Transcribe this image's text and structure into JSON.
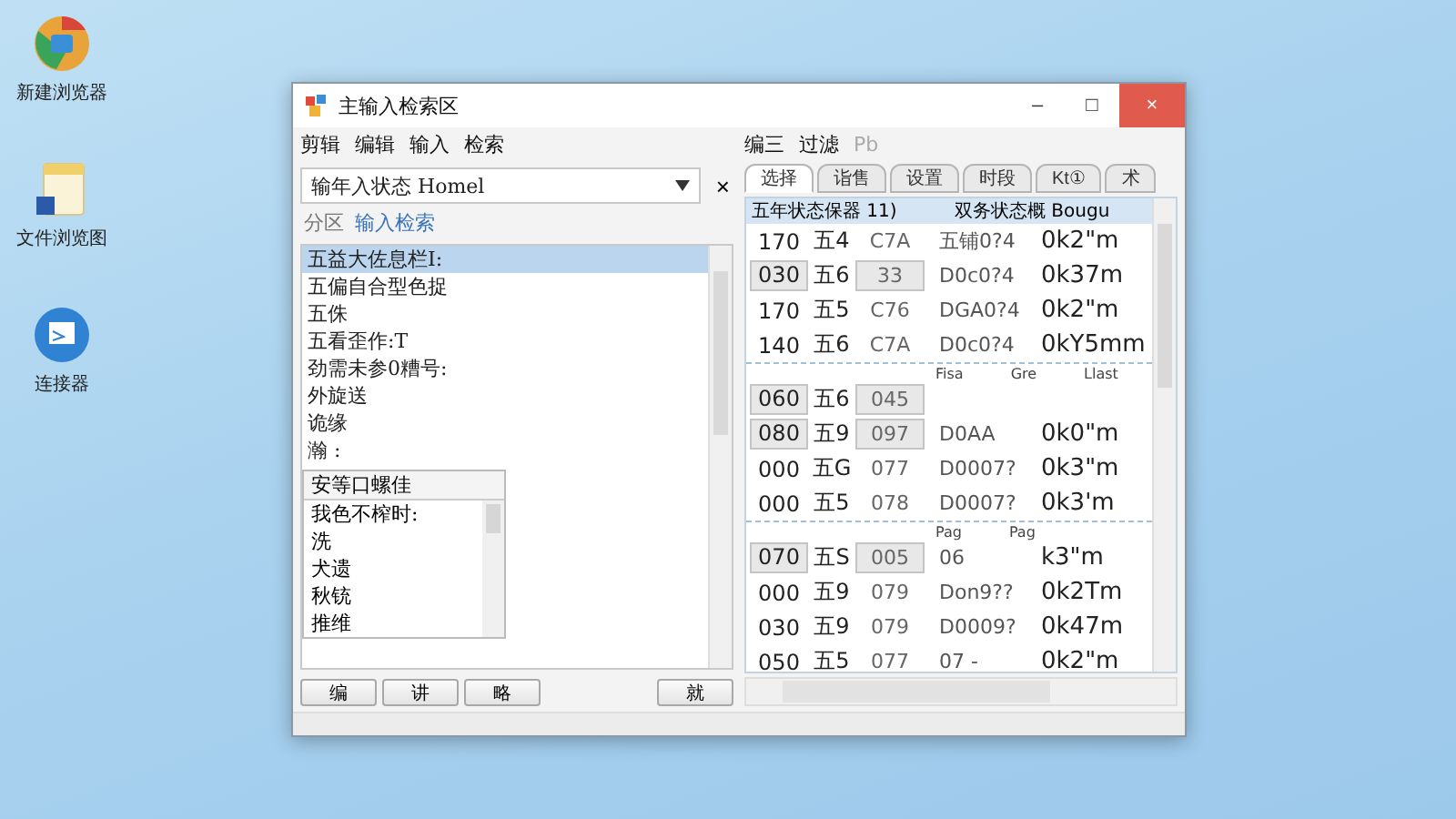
{
  "desktop_icons": [
    {
      "label": "新建浏览器",
      "kind": "browser"
    },
    {
      "label": "文件浏览图",
      "kind": "file"
    },
    {
      "label": "连接器",
      "kind": "app"
    }
  ],
  "window": {
    "title": "主输入检索区",
    "controls": [
      "–",
      "□",
      "×"
    ]
  },
  "menu_left": [
    {
      "label": "剪辑",
      "disabled": false
    },
    {
      "label": "编辑",
      "disabled": false
    },
    {
      "label": "输入",
      "disabled": false
    },
    {
      "label": "检索",
      "disabled": false
    }
  ],
  "menu_right": [
    {
      "label": "编三",
      "disabled": false
    },
    {
      "label": "过滤",
      "disabled": false
    },
    {
      "label": "Pb",
      "disabled": true
    }
  ],
  "search": {
    "value": "输年入状态 Homel",
    "clear": "×"
  },
  "search_hint": {
    "label": "分区",
    "link": "输入检索"
  },
  "list": [
    {
      "label": "五益大佐息栏I:",
      "selected": true
    },
    {
      "label": "五偏自合型色捉",
      "selected": false
    },
    {
      "label": "五侏",
      "selected": false
    },
    {
      "label": "五看歪作:T",
      "selected": false
    },
    {
      "label": "劲需未参0糟号:",
      "selected": false
    },
    {
      "label": "外旋送",
      "selected": false
    },
    {
      "label": "诡缘",
      "selected": false
    },
    {
      "label": "瀚  :",
      "selected": false
    }
  ],
  "dropdown": {
    "header": "安等口螺佳",
    "items": [
      "我色不榨时:",
      "洗",
      "犬遗",
      "秋铳",
      "推维"
    ]
  },
  "left_buttons": [
    "编",
    "讲",
    "略"
  ],
  "right_button": "就",
  "tabs": [
    {
      "label": "选择",
      "selected": true
    },
    {
      "label": "诣售",
      "selected": false
    },
    {
      "label": "设置",
      "selected": false
    },
    {
      "label": "时段",
      "selected": false
    },
    {
      "label": "Kt①",
      "selected": false
    },
    {
      "label": "术",
      "selected": false
    }
  ],
  "table": {
    "columns": [
      "五年状态保器 11)",
      "双务状态概 Bougu"
    ],
    "groups": [
      {
        "rows": [
          {
            "cells": [
              "170",
              "五4",
              "C7A",
              "五铺0?4",
              "0k2\"m"
            ],
            "boxed": false
          },
          {
            "cells": [
              "030",
              "五6",
              "33",
              "D0c0?4",
              "0k37m"
            ],
            "boxed": true
          },
          {
            "cells": [
              "170",
              "五5",
              "C76",
              "DGA0?4",
              "0k2\"m"
            ],
            "boxed": false
          },
          {
            "cells": [
              "140",
              "五6",
              "C7A",
              "D0c0?4",
              "0kY5mm"
            ],
            "boxed": false
          }
        ]
      },
      {
        "labels": [
          "Fisa",
          "Gre",
          "Llast"
        ],
        "rows": [
          {
            "cells": [
              "060",
              "五6",
              "045"
            ],
            "boxed": true
          },
          {
            "cells": [
              "080",
              "五9",
              "097",
              "D0AA",
              "0k0\"m"
            ],
            "boxed": true
          },
          {
            "cells": [
              "000",
              "五G",
              "077",
              "D0007?",
              "0k3\"m"
            ],
            "boxed": false
          },
          {
            "cells": [
              "000",
              "五5",
              "078",
              "D0007?",
              "0k3'm"
            ],
            "boxed": false
          }
        ]
      },
      {
        "labels": [
          "Pag",
          "Pag"
        ],
        "rows": [
          {
            "cells": [
              "070",
              "五S",
              "005",
              "06",
              "k3\"m"
            ],
            "boxed": true
          },
          {
            "cells": [
              "000",
              "五9",
              "079",
              "Don9??",
              "0k2Tm"
            ],
            "boxed": false
          },
          {
            "cells": [
              "030",
              "五9",
              "079",
              "D0009?",
              "0k47m"
            ],
            "boxed": false
          },
          {
            "cells": [
              "050",
              "五5",
              "077",
              "07 -",
              "0k2\"m"
            ],
            "boxed": false
          }
        ]
      }
    ]
  }
}
